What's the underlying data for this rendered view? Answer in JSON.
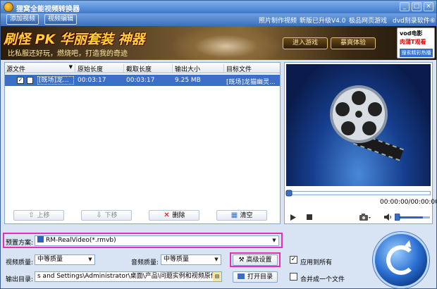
{
  "window": {
    "title": "狸窝全能视频转换器"
  },
  "topbar": {
    "tabs": [
      {
        "label": "添加视频"
      },
      {
        "label": "视频编辑"
      }
    ],
    "links": [
      {
        "label": "照片制作视频"
      },
      {
        "label": "新版已升级V4.0"
      },
      {
        "label": "极品网页游戏"
      },
      {
        "label": "dvd刻录软件⑥"
      }
    ]
  },
  "banner": {
    "headline": "刷怪 PK 华丽套装 神器",
    "subtitle": "比私服还好玩，燃烧吧，打造我的奇迹",
    "enter_game": "进入游戏",
    "experience": "暴爽体验",
    "vod_brand": "vod电影",
    "vod_tag": "肉蒲T观看",
    "vod_search": "搜索精彩热播"
  },
  "filelist": {
    "columns": [
      {
        "label": "源文件"
      },
      {
        "label": "原始长度"
      },
      {
        "label": "截取长度"
      },
      {
        "label": "输出大小"
      },
      {
        "label": "目标文件"
      }
    ],
    "rows": [
      {
        "source": "[既场]龙...",
        "original_length": "00:03:17",
        "clip_length": "00:03:17",
        "output_size": "9.25 MB",
        "target": "[既场]龙猫幽灵..."
      }
    ],
    "buttons": {
      "up": "上移",
      "down": "下移",
      "delete": "删除",
      "clear": "清空"
    }
  },
  "preview": {
    "time": "00:00:00/00:00:00"
  },
  "format": {
    "preset_label": "预置方案:",
    "preset_value": "RM-RealVideo(*.rmvb)",
    "video_quality_label": "视频质量:",
    "video_quality_value": "中等质量",
    "audio_quality_label": "音频质量:",
    "audio_quality_value": "中等质量",
    "advanced_button": "高级设置",
    "apply_all_label": "应用到所有",
    "apply_all_checked": true,
    "output_dir_label": "输出目录:",
    "output_dir_value": "s and Settings\\Administrator\\桌面\\产品\\问题实例和视频原件\\转换",
    "open_dir_button": "打开目录",
    "merge_label": "合并成一个文件",
    "merge_checked": false
  },
  "colors": {
    "highlight": "#e62fb9",
    "selection": "#3a6fc6",
    "titlebar": "#3f78c8"
  }
}
